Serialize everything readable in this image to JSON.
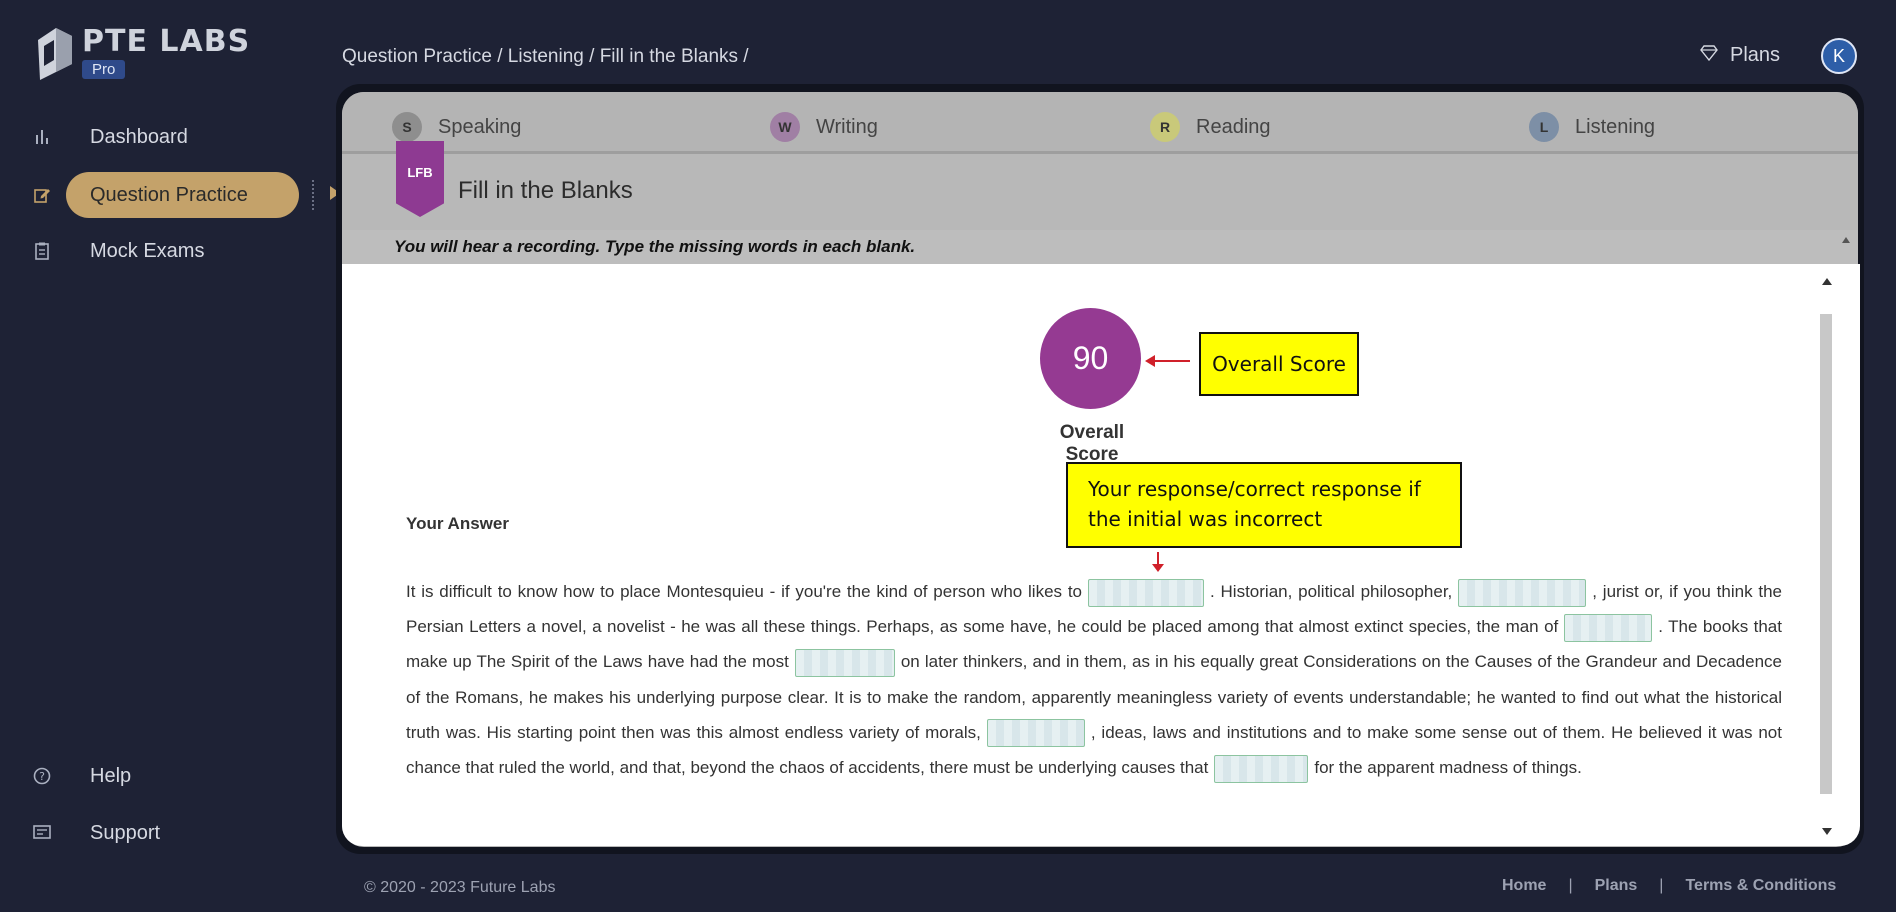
{
  "brand": {
    "title": "PTE LABS",
    "badge": "Pro"
  },
  "sidebar": {
    "items": [
      {
        "label": "Dashboard",
        "icon": "bar-chart-icon"
      },
      {
        "label": "Question Practice",
        "icon": "edit-icon",
        "active": true
      },
      {
        "label": "Mock Exams",
        "icon": "clipboard-icon"
      }
    ],
    "bottom": [
      {
        "label": "Help",
        "icon": "help-icon"
      },
      {
        "label": "Support",
        "icon": "support-icon"
      }
    ]
  },
  "header": {
    "breadcrumb": "Question Practice / Listening / Fill in the Blanks /",
    "plans_label": "Plans",
    "avatar_initial": "K"
  },
  "tabs": [
    {
      "label": "Speaking",
      "icon_letter": "S",
      "color": "#8e8e8e"
    },
    {
      "label": "Writing",
      "icon_letter": "W",
      "color": "#a07fa4"
    },
    {
      "label": "Reading",
      "icon_letter": "R",
      "color": "#c9c97a"
    },
    {
      "label": "Listening",
      "icon_letter": "L",
      "color": "#7d8fa6"
    }
  ],
  "question": {
    "code": "LFB",
    "title": "Fill in the Blanks",
    "instruction": "You will hear a recording. Type the missing words in each blank."
  },
  "result": {
    "score": "90",
    "score_label": "Overall Score",
    "callout_score": "Overall Score",
    "callout_response": "Your response/correct response if the initial was incorrect",
    "answer_heading": "Your Answer",
    "passage": {
      "p1": "It is difficult to know how to place Montesquieu - if you're the kind of person who likes to",
      "p2": ". Historian, political philosopher,",
      "p3": ", jurist or, if you think the Persian Letters a novel, a novelist - he was all these things. Perhaps, as some have, he could be placed among that almost extinct species, the man of",
      "p4": ". The books that make up The Spirit of the Laws have had the most",
      "p5": "on later thinkers, and in them, as in his equally great Considerations on the Causes of the Grandeur and Decadence of the Romans, he makes his underlying purpose clear. It is to make the random, apparently meaningless variety of events understandable; he wanted to find out what the historical truth was. His starting point then was this almost endless variety of morals,",
      "p6": ", ideas, laws and institutions and to make some sense out of them. He believed it was not chance that ruled the world, and that, beyond the chaos of accidents, there must be underlying causes that",
      "p7": "for the apparent madness of things."
    }
  },
  "footer": {
    "copyright": "© 2020 - 2023 Future Labs",
    "links": [
      "Home",
      "Plans",
      "Terms & Conditions"
    ],
    "separator": "|"
  },
  "colors": {
    "accent": "#c4a26a",
    "score": "#953a92",
    "callout": "#ffff00",
    "background": "#1e2235"
  }
}
